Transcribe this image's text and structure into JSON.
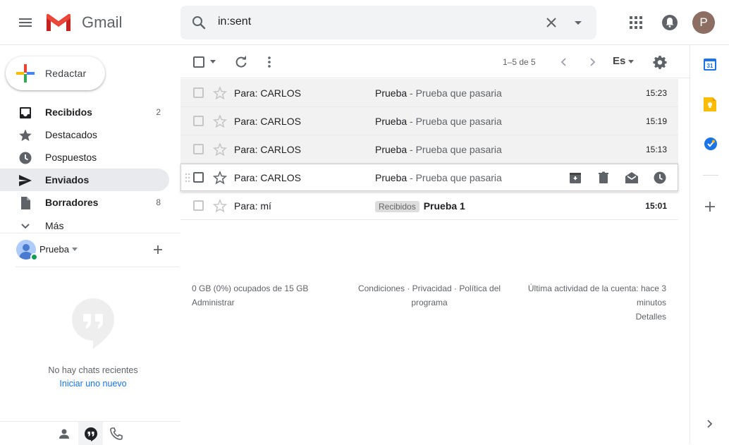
{
  "header": {
    "logo_text": "Gmail",
    "search_value": "in:sent",
    "avatar_letter": "P"
  },
  "compose": {
    "label": "Redactar"
  },
  "nav": {
    "items": [
      {
        "label": "Recibidos",
        "count": "2",
        "icon": "inbox-icon",
        "bold": true,
        "active": false
      },
      {
        "label": "Destacados",
        "count": "",
        "icon": "star-icon",
        "bold": false,
        "active": false
      },
      {
        "label": "Pospuestos",
        "count": "",
        "icon": "clock-icon",
        "bold": false,
        "active": false
      },
      {
        "label": "Enviados",
        "count": "",
        "icon": "send-icon",
        "bold": true,
        "active": true
      },
      {
        "label": "Borradores",
        "count": "8",
        "icon": "draft-icon",
        "bold": true,
        "active": false
      },
      {
        "label": "Más",
        "count": "",
        "icon": "chevron-down-icon",
        "bold": false,
        "active": false
      }
    ]
  },
  "chat": {
    "user_name": "Prueba",
    "no_chats": "No hay chats recientes",
    "start_chat": "Iniciar uno nuevo"
  },
  "toolbar": {
    "range": "1–5 de 5",
    "lang": "Es"
  },
  "messages": [
    {
      "sender": "Para: CARLOS",
      "subject": "Prueba",
      "snippet": " - Prueba que pasaria",
      "time": "15:23",
      "label": "",
      "unread": false
    },
    {
      "sender": "Para: CARLOS",
      "subject": "Prueba",
      "snippet": " - Prueba que pasaria",
      "time": "15:19",
      "label": "",
      "unread": false
    },
    {
      "sender": "Para: CARLOS",
      "subject": "Prueba",
      "snippet": " - Prueba que pasaria",
      "time": "15:13",
      "label": "",
      "unread": false
    },
    {
      "sender": "Para: CARLOS",
      "subject": "Prueba",
      "snippet": " - Prueba que pasaria",
      "time": "",
      "label": "",
      "unread": false
    },
    {
      "sender": "Para: mí",
      "subject": "Prueba 1",
      "snippet": "",
      "time": "15:01",
      "label": "Recibidos",
      "unread": true
    }
  ],
  "footer": {
    "storage": "0 GB (0%) ocupados de 15 GB",
    "manage": "Administrar",
    "terms": "Condiciones",
    "privacy": "Privacidad",
    "policy": "Política del programa",
    "activity": "Última actividad de la cuenta: hace 3 minutos",
    "details": "Detalles"
  },
  "colors": {
    "active_nav_bg": "#e8eaed",
    "read_row_bg": "#f2f2f2",
    "link_blue": "#1a73e8",
    "online_green": "#0f9d58"
  }
}
